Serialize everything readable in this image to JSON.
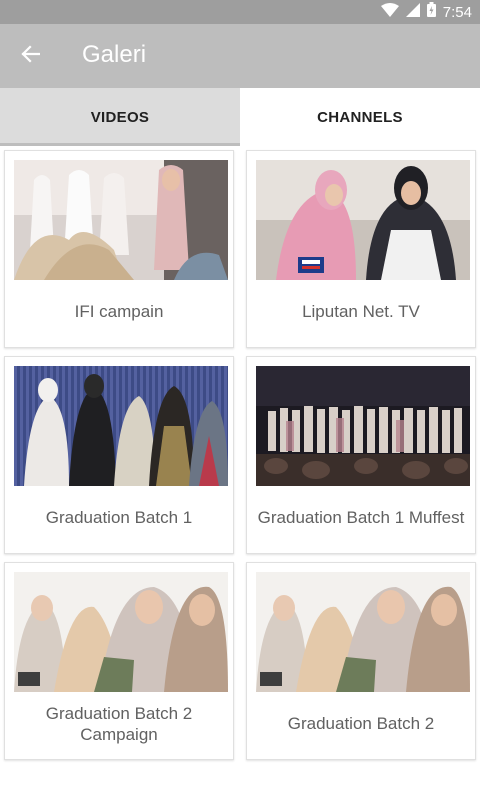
{
  "status_bar": {
    "time": "7:54"
  },
  "app_bar": {
    "title": "Galeri"
  },
  "tabs": [
    {
      "label": "VIDEOS",
      "selected": true
    },
    {
      "label": "CHANNELS",
      "selected": false
    }
  ],
  "videos": [
    {
      "title": "IFI campain"
    },
    {
      "title": "Liputan Net. TV"
    },
    {
      "title": "Graduation Batch 1"
    },
    {
      "title": "Graduation Batch 1 Muffest"
    },
    {
      "title": "Graduation Batch 2 Campaign"
    },
    {
      "title": "Graduation Batch 2"
    }
  ],
  "colors": {
    "status_bar": "#9e9e9e",
    "app_bar": "#bdbdbd",
    "tab_selected_bg": "#dcdcdc"
  }
}
